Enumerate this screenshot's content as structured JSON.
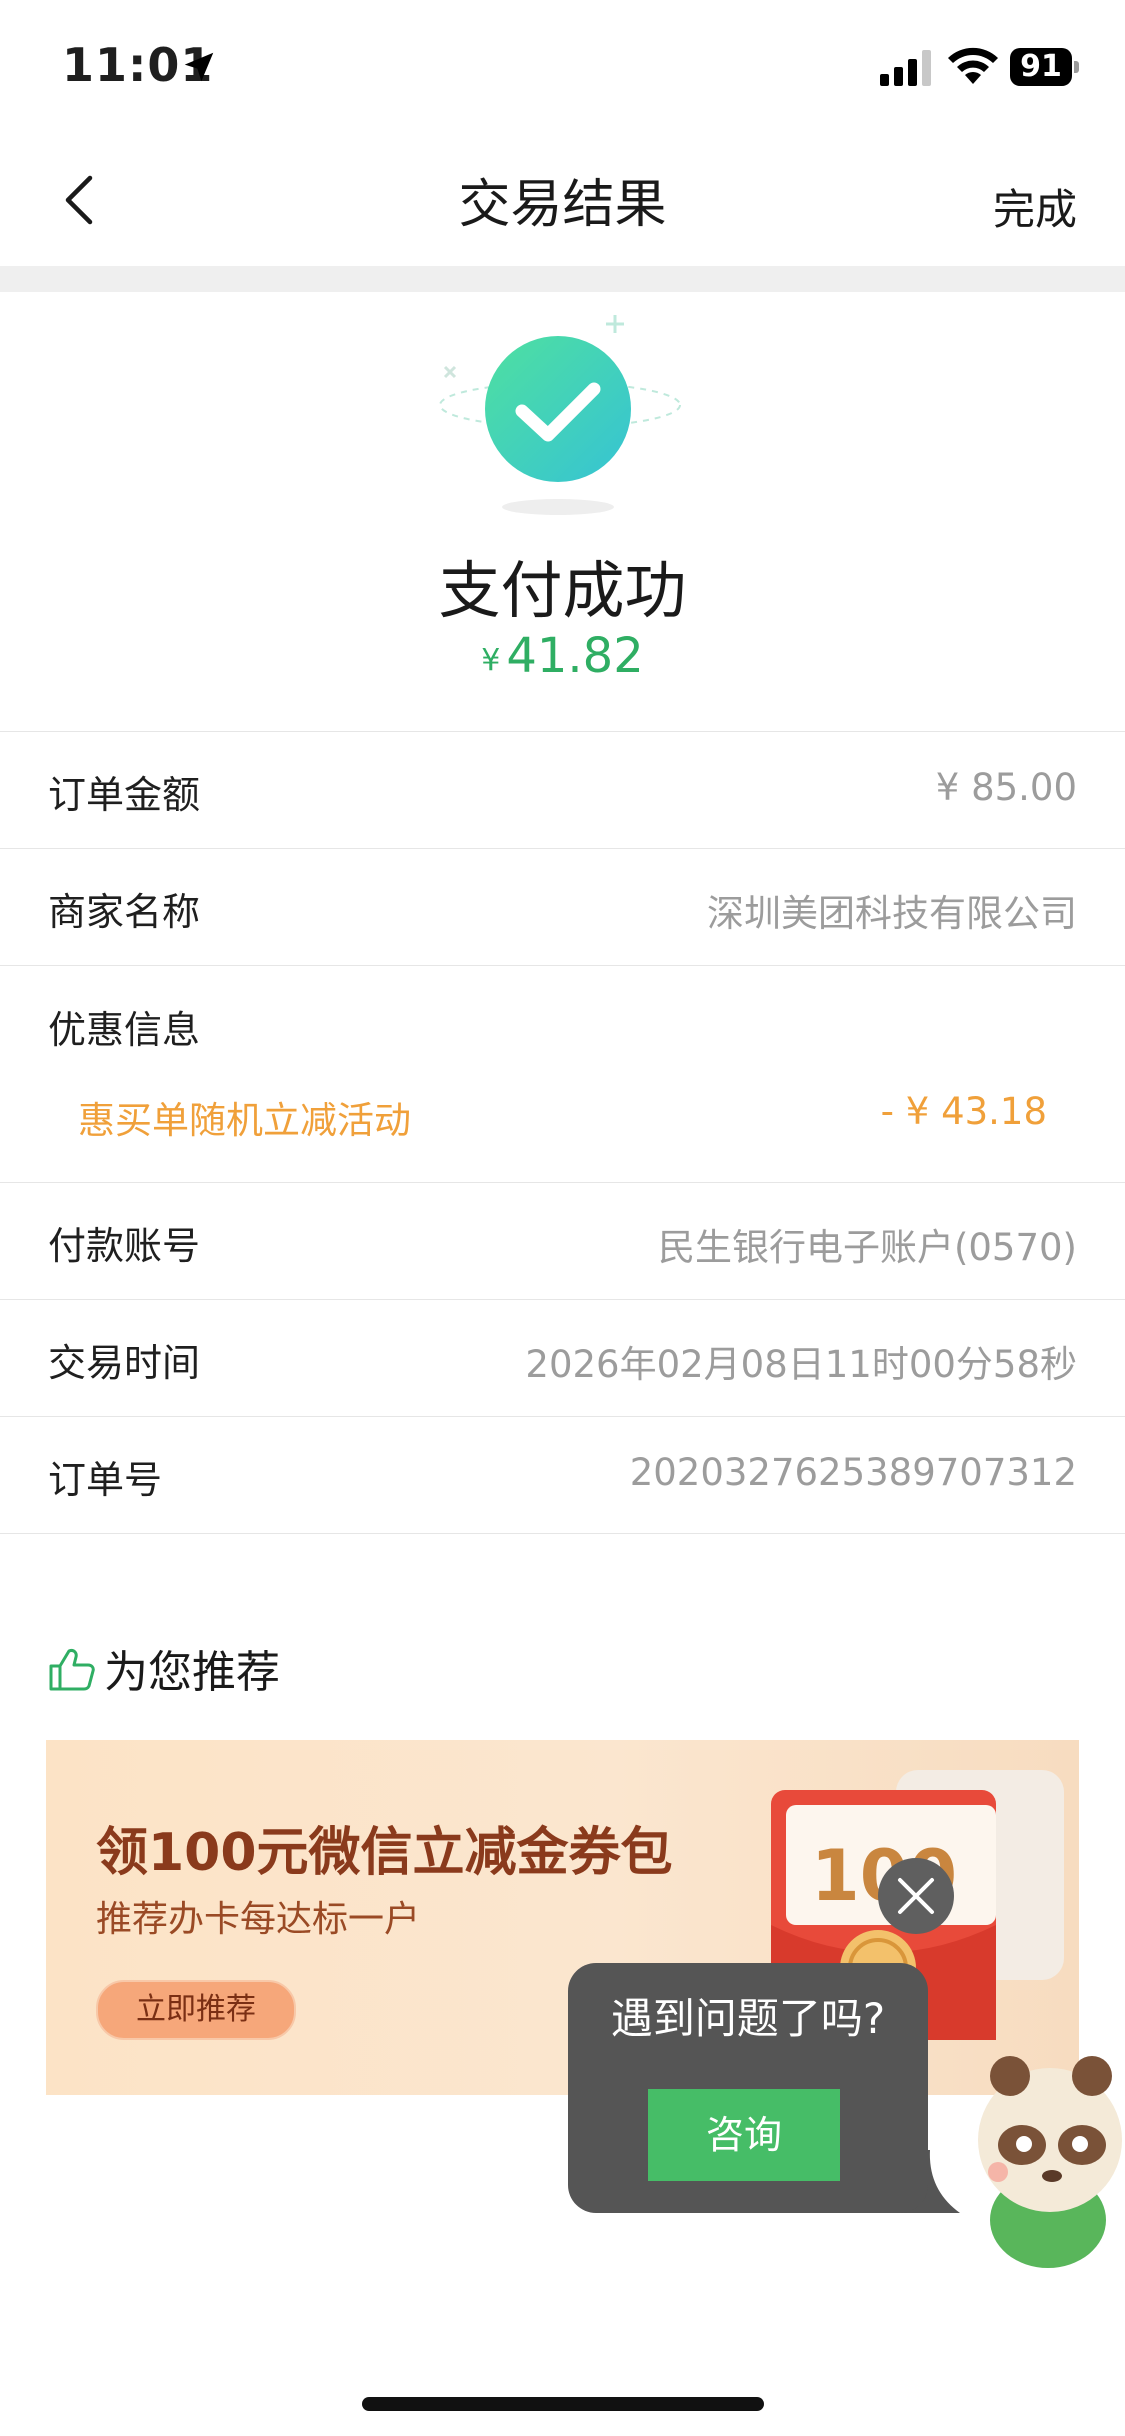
{
  "status_bar": {
    "time": "11:01",
    "battery": "91"
  },
  "nav": {
    "title": "交易结果",
    "done_label": "完成"
  },
  "result": {
    "title": "支付成功",
    "currency": "¥",
    "amount": "41.82"
  },
  "details": {
    "order_amount": {
      "label": "订单金额",
      "value": "¥ 85.00"
    },
    "merchant": {
      "label": "商家名称",
      "value": "深圳美团科技有限公司"
    },
    "discount": {
      "label": "优惠信息",
      "name": "惠买单随机立减活动",
      "value": "- ¥ 43.18"
    },
    "account": {
      "label": "付款账号",
      "value": "民生银行电子账户(0570)"
    },
    "time": {
      "label": "交易时间",
      "value": "2026年02月08日11时00分58秒"
    },
    "order_no": {
      "label": "订单号",
      "value": "2020327625389707312"
    }
  },
  "recommend": {
    "heading": "为您推荐",
    "banner": {
      "title": "领100元微信立减金券包",
      "subtitle": "推荐办卡每达标一户",
      "button_label": "立即推荐",
      "art_amount": "100"
    }
  },
  "help": {
    "question": "遇到问题了吗?",
    "consult_label": "咨询"
  },
  "colors": {
    "success": "#2fae63",
    "discount": "#f0a03a",
    "consult": "#46bd67"
  }
}
